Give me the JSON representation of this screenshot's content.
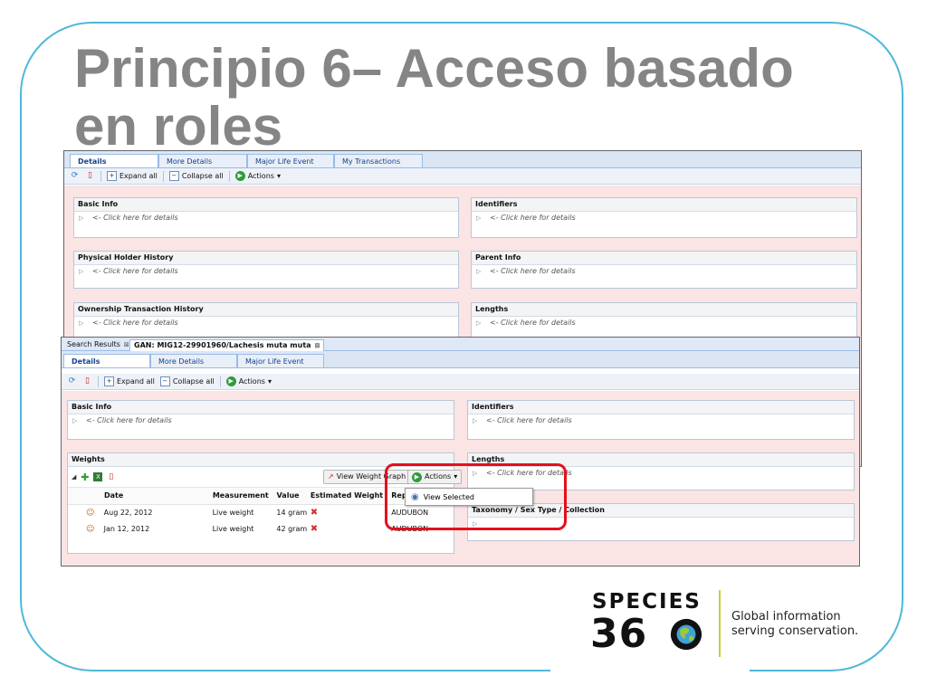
{
  "slide": {
    "title": "Principio 6– Acceso basado en roles"
  },
  "shot1": {
    "tabs": [
      "Details",
      "More Details",
      "Major Life Event",
      "My Transactions"
    ],
    "toolbar": {
      "expand": "Expand all",
      "collapse": "Collapse all",
      "actions": "Actions"
    },
    "panels": [
      {
        "title": "Basic Info",
        "row": "<- Click here for details"
      },
      {
        "title": "Identifiers",
        "row": "<- Click here for details"
      },
      {
        "title": "Physical Holder History",
        "row": "<- Click here for details"
      },
      {
        "title": "Parent Info",
        "row": "<- Click here for details"
      },
      {
        "title": "Ownership Transaction History",
        "row": "<- Click here for details"
      },
      {
        "title": "Lengths",
        "row": "<- Click here for details"
      }
    ]
  },
  "shot2": {
    "doctabs": [
      "Search Results",
      "GAN: MIG12-29901960/Lachesis muta muta"
    ],
    "tabs": [
      "Details",
      "More Details",
      "Major Life Event"
    ],
    "toolbar": {
      "expand": "Expand all",
      "collapse": "Collapse all",
      "actions": "Actions"
    },
    "basic_info": {
      "title": "Basic Info",
      "row": "<- Click here for details"
    },
    "identifiers": {
      "title": "Identifiers",
      "row": "<- Click here for details"
    },
    "weights": {
      "title": "Weights",
      "view_graph": "View Weight Graph",
      "actions": "Actions",
      "columns": [
        "Date",
        "Measurement",
        "Value",
        "Estimated Weight",
        "Reported by"
      ],
      "rows": [
        {
          "date": "Aug 22, 2012",
          "measurement": "Live weight",
          "value": "14 gram",
          "reported": "AUDUBON"
        },
        {
          "date": "Jan 12, 2012",
          "measurement": "Live weight",
          "value": "42 gram",
          "reported": "AUDUBON"
        }
      ]
    },
    "lengths": {
      "title": "Lengths",
      "row": "<- Click here for details"
    },
    "taxonomy": {
      "title": "Taxonomy / Sex Type / Collection"
    },
    "menu": {
      "view_selected": "View Selected"
    }
  },
  "logo": {
    "brand_top": "SPECIES",
    "brand_num": "36",
    "tagline_1": "Global information",
    "tagline_2": "serving conservation."
  },
  "colors": {
    "frame": "#4fb8da",
    "title": "#858585",
    "highlight": "#e5101c",
    "logo_divider": "#c3cf3b"
  }
}
